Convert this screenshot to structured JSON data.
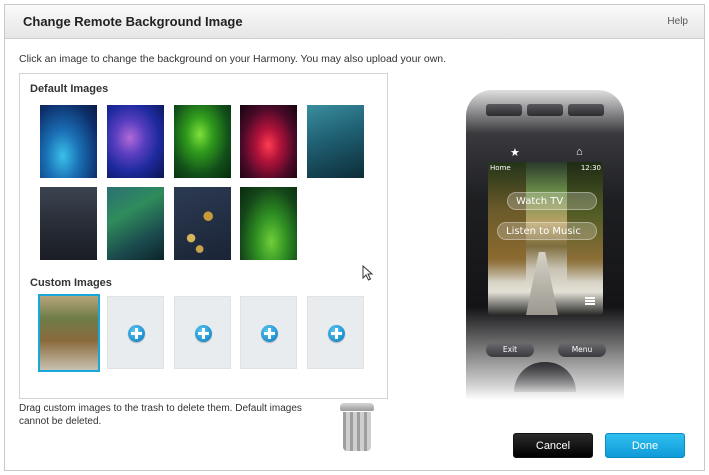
{
  "dialog": {
    "title": "Change Remote Background Image",
    "help_label": "Help",
    "instructions": "Click an image to change the background on your Harmony. You may also upload your own."
  },
  "default_images": {
    "label": "Default Images",
    "thumbnails": [
      "blue",
      "purple",
      "green",
      "red",
      "teal",
      "slate",
      "aurora",
      "koi",
      "leaf"
    ]
  },
  "custom_images": {
    "label": "Custom Images",
    "selected_index": 0,
    "add_slots": 4
  },
  "footer": {
    "note": "Drag custom images to the trash to delete them. Default images cannot be deleted.",
    "cancel_label": "Cancel",
    "done_label": "Done"
  },
  "remote_preview": {
    "status_left": "Home",
    "status_time": "12:30",
    "activity_1": "Watch TV",
    "activity_2": "Listen to Music",
    "exit_label": "Exit",
    "menu_label": "Menu"
  },
  "colors": {
    "accent": "#19a6d8",
    "done_button": "#1ba9e1",
    "cancel_button": "#111111"
  }
}
